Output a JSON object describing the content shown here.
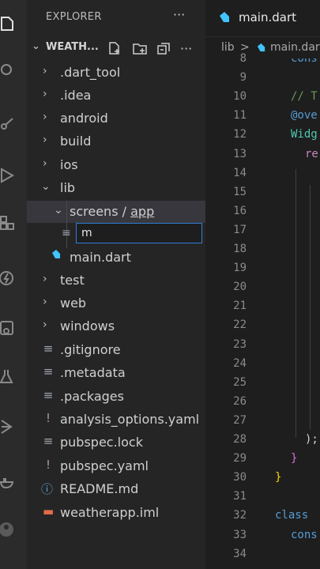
{
  "activity_icons": [
    "files-icon",
    "search-icon",
    "source-control-icon",
    "run-debug-icon",
    "extensions-icon",
    "flutter-icon",
    "remote-explorer-icon",
    "testing-icon",
    "dart-devtools-icon",
    "docker-icon",
    "account-icon"
  ],
  "sidebar": {
    "title": "EXPLORER",
    "more": "···",
    "project": "WEATH...",
    "tree": [
      {
        "label": ".dart_tool",
        "type": "folder"
      },
      {
        "label": ".idea",
        "type": "folder"
      },
      {
        "label": "android",
        "type": "folder"
      },
      {
        "label": "build",
        "type": "folder"
      },
      {
        "label": "ios",
        "type": "folder"
      },
      {
        "label": "lib",
        "type": "folder-open"
      },
      {
        "label_a": "screens",
        "sep": "/",
        "label_b": "app",
        "type": "folder-open"
      },
      {
        "label": "main.dart",
        "type": "dart"
      },
      {
        "label": "test",
        "type": "folder"
      },
      {
        "label": "web",
        "type": "folder"
      },
      {
        "label": "windows",
        "type": "folder"
      },
      {
        "label": ".gitignore",
        "type": "file"
      },
      {
        "label": ".metadata",
        "type": "file"
      },
      {
        "label": ".packages",
        "type": "file"
      },
      {
        "label": "analysis_options.yaml",
        "type": "yaml"
      },
      {
        "label": "pubspec.lock",
        "type": "file"
      },
      {
        "label": "pubspec.yaml",
        "type": "yaml"
      },
      {
        "label": "README.md",
        "type": "info"
      },
      {
        "label": "weatherapp.iml",
        "type": "iml"
      }
    ],
    "new_file_value": "m"
  },
  "editor": {
    "tab_label": "main.dart",
    "breadcrumb": [
      "lib",
      ">",
      "main.dart"
    ],
    "line_numbers": [
      "8",
      "9",
      "10",
      "11",
      "12",
      "13",
      "14",
      "15",
      "16",
      "17",
      "18",
      "19",
      "20",
      "21",
      "22",
      "23",
      "24",
      "25",
      "26",
      "27",
      "28",
      "29",
      "30",
      "31",
      "32",
      "33",
      "34"
    ],
    "code": [
      {
        "line": "8",
        "text": "cons",
        "color": "#569cd6",
        "indent": 48
      },
      {
        "line": "10",
        "text": "// T",
        "color": "#6a9955",
        "indent": 48
      },
      {
        "line": "11",
        "text": "@ove",
        "color": "#569cd6",
        "indent": 48
      },
      {
        "line": "12",
        "text": "Widg",
        "color": "#4ec9b0",
        "indent": 48
      },
      {
        "line": "13",
        "text": "re",
        "color": "#c586c0",
        "indent": 66
      },
      {
        "line": "28",
        "text": ");",
        "color": "#d4d4d4",
        "indent": 66
      },
      {
        "line": "29",
        "text": "}",
        "color": "#da70d6",
        "indent": 48
      },
      {
        "line": "30",
        "text": "}",
        "color": "#ffd700",
        "indent": 28
      },
      {
        "line": "32",
        "text": "class",
        "color": "#569cd6",
        "indent": 28
      },
      {
        "line": "33",
        "text": "cons",
        "color": "#569cd6",
        "indent": 48
      }
    ]
  },
  "colors": {
    "accent": "#2f7fd6",
    "dart_blue": "#40c4ff"
  }
}
